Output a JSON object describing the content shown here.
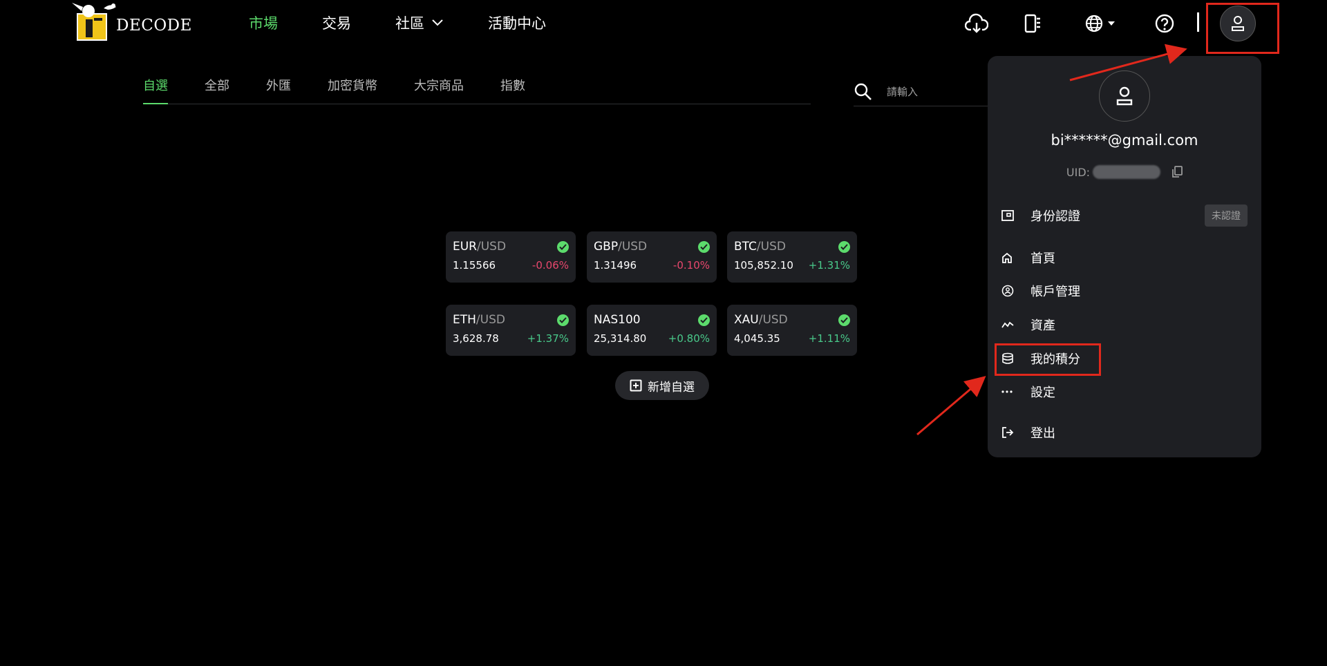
{
  "brand": {
    "name": "DECODE"
  },
  "nav": [
    {
      "label": "市場",
      "active": true
    },
    {
      "label": "交易",
      "active": false
    },
    {
      "label": "社區",
      "active": false,
      "dropdown": true
    },
    {
      "label": "活動中心",
      "active": false
    }
  ],
  "header_icons": [
    "cloud-download-icon",
    "device-swap-icon",
    "globe-icon",
    "help-icon",
    "user-icon"
  ],
  "tabs": [
    {
      "label": "自選",
      "active": true
    },
    {
      "label": "全部"
    },
    {
      "label": "外匯"
    },
    {
      "label": "加密貨幣"
    },
    {
      "label": "大宗商品"
    },
    {
      "label": "指數"
    }
  ],
  "search": {
    "placeholder": "請輸入"
  },
  "watchlist": [
    {
      "base": "EUR",
      "quote": "/USD",
      "price": "1.15566",
      "change": "-0.06%",
      "dir": "neg"
    },
    {
      "base": "GBP",
      "quote": "/USD",
      "price": "1.31496",
      "change": "-0.10%",
      "dir": "neg"
    },
    {
      "base": "BTC",
      "quote": "/USD",
      "price": "105,852.10",
      "change": "+1.31%",
      "dir": "pos"
    },
    {
      "base": "ETH",
      "quote": "/USD",
      "price": "3,628.78",
      "change": "+1.37%",
      "dir": "pos"
    },
    {
      "base": "NAS100",
      "quote": "",
      "price": "25,314.80",
      "change": "+0.80%",
      "dir": "pos"
    },
    {
      "base": "XAU",
      "quote": "/USD",
      "price": "4,045.35",
      "change": "+1.11%",
      "dir": "pos"
    }
  ],
  "add_watchlist": {
    "label": "新增自選"
  },
  "account": {
    "email": "bi******@gmail.com",
    "uid_label": "UID:",
    "menu": [
      {
        "label": "身份認證",
        "icon": "id-card-icon",
        "badge": "未認證"
      },
      {
        "label": "首頁",
        "icon": "home-icon"
      },
      {
        "label": "帳戶管理",
        "icon": "account-icon"
      },
      {
        "label": "資產",
        "icon": "assets-chart-icon"
      },
      {
        "label": "我的積分",
        "icon": "coins-icon"
      },
      {
        "label": "設定",
        "icon": "more-dots-icon"
      },
      {
        "label": "登出",
        "icon": "logout-icon"
      }
    ]
  },
  "colors": {
    "accent_green": "#5cdb6c",
    "negative": "#e8476d",
    "positive": "#49c98a",
    "highlight": "#e1281c"
  }
}
